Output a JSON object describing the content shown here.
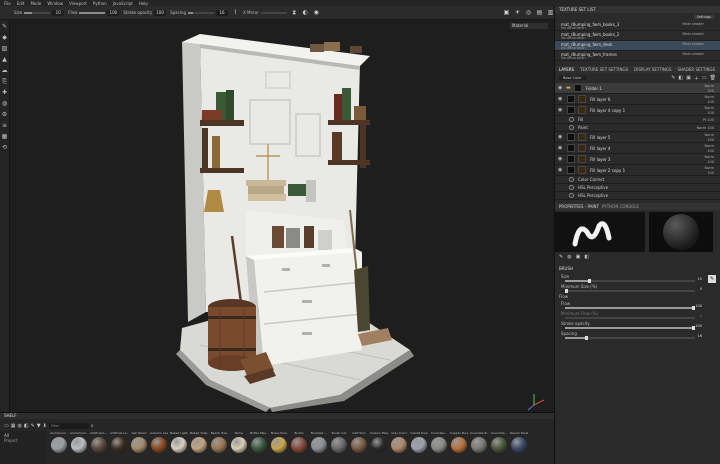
{
  "menu": [
    "File",
    "Edit",
    "Mode",
    "Window",
    "Viewport",
    "Python",
    "JavaScript",
    "Help"
  ],
  "toolbar": {
    "size_label": "Size",
    "size_value": "10",
    "flow_label": "Flow",
    "flow_value": "100",
    "stroke_label": "Stroke opacity",
    "stroke_value": "100",
    "spacing_label": "Spacing",
    "spacing_value": "16",
    "symmetry_label": "X Mirror"
  },
  "viewport": {
    "display_mode": "Material"
  },
  "texture_set_list": {
    "title": "TEXTURE SET LIST",
    "settings_label": "Settings",
    "items": [
      {
        "name": "mat_rBumping_fwm_books_3",
        "sub": "No decoration",
        "shader": "Main shader"
      },
      {
        "name": "mat_rBumping_fwm_books_2",
        "sub": "No decoration",
        "shader": "Main shader"
      },
      {
        "name": "mat_rBumping_fwm_desk",
        "sub": "No decoration",
        "shader": "Main shader"
      },
      {
        "name": "mat_rBumping_fwm_frames",
        "sub": "No decoration",
        "shader": "Main shader"
      }
    ]
  },
  "layers": {
    "tabs": [
      "LAYERS",
      "TEXTURE SET SETTINGS",
      "DISPLAY SETTINGS",
      "SHADER SETTINGS"
    ],
    "channel_select": "Base Color",
    "items": [
      {
        "name": "Folder 1",
        "blend": "Norm",
        "opacity": "100"
      },
      {
        "name": "Fill layer 6",
        "blend": "Norm",
        "opacity": "100"
      },
      {
        "name": "Fill layer 4 copy 1",
        "blend": "Norm",
        "opacity": "100"
      },
      {
        "name": "Fill layer 5",
        "blend": "Norm",
        "opacity": "100"
      },
      {
        "name": "Fill layer 4",
        "blend": "Norm",
        "opacity": "100"
      },
      {
        "name": "Fill layer 3",
        "blend": "Norm",
        "opacity": "100"
      },
      {
        "name": "Fill layer 2 copy 1",
        "blend": "Norm",
        "opacity": "100"
      }
    ],
    "sub_items": [
      {
        "name": "Fill",
        "blend": "Pt 100"
      },
      {
        "name": "Paint",
        "blend": "Norm 100"
      }
    ],
    "effects": [
      "Color Correct",
      "HSL Perceptive",
      "HSL Perceptive"
    ]
  },
  "properties": {
    "tabs": [
      "PROPERTIES - PAINT",
      "PYTHON CONSOLE"
    ],
    "section": "BRUSH",
    "size_label": "Size",
    "size_value": "10",
    "min_size_label": "Minimum Size (%)",
    "min_size_value": "0",
    "flow_section": "Flow",
    "flow_label": "Flow",
    "flow_value": "100",
    "min_flow_label": "Minimum Flow (%)",
    "min_flow_value": "0",
    "stroke_label": "Stroke opacity",
    "stroke_value": "100",
    "spacing_label": "Spacing",
    "spacing_value": "16",
    "size_level": 0.18,
    "flow_level": 1.0,
    "stroke_level": 1.0,
    "spacing_level": 0.16
  },
  "shelf": {
    "title": "SHELF",
    "search_placeholder": "Filter",
    "categories": [
      "All",
      "Project"
    ],
    "materials": [
      {
        "name": "Aluminium ...",
        "color": "#9aa1a6"
      },
      {
        "name": "Aluminium ...",
        "color": "#b9bec2"
      },
      {
        "name": "Artificial L...",
        "color": "#5c4a3a"
      },
      {
        "name": "Artificial Le...",
        "color": "#3f2e22"
      },
      {
        "name": "Ash Wood",
        "color": "#a48a6a"
      },
      {
        "name": "Autumn Leaf",
        "color": "#8b4a22"
      },
      {
        "name": "Baked Light...",
        "color": "#d8d0c0"
      },
      {
        "name": "Baked Triap...",
        "color": "#c4a37a"
      },
      {
        "name": "Beech Tree",
        "color": "#9b7550"
      },
      {
        "name": "Bone",
        "color": "#d8cfb5"
      },
      {
        "name": "Bottle Plas...",
        "color": "#3a5a40"
      },
      {
        "name": "Brass Pure",
        "color": "#c9a64a"
      },
      {
        "name": "Bricks",
        "color": "#8a4a3a"
      },
      {
        "name": "Brushed ...",
        "color": "#8c9196"
      },
      {
        "name": "Brush Cot",
        "color": "#6a6a6a"
      },
      {
        "name": "Calf Skin",
        "color": "#7a5a40"
      },
      {
        "name": "Carbon Fiber",
        "color": "#2a2a2a"
      },
      {
        "name": "Clay Cracl",
        "color": "#b0886a"
      },
      {
        "name": "Cobalt Pure",
        "color": "#9aa3b0"
      },
      {
        "name": "Concrete...",
        "color": "#8a8a86"
      },
      {
        "name": "Copper Pure",
        "color": "#b8703a"
      },
      {
        "name": "Concrete B...",
        "color": "#7a7a76"
      },
      {
        "name": "Crocodile...",
        "color": "#4a5a3a"
      },
      {
        "name": "Denim Rivet",
        "color": "#3a4a6a"
      }
    ]
  },
  "colors": {
    "accent": "#3a4a5a",
    "bg": "#1e1e1e",
    "panel": "#2a2a2a"
  }
}
